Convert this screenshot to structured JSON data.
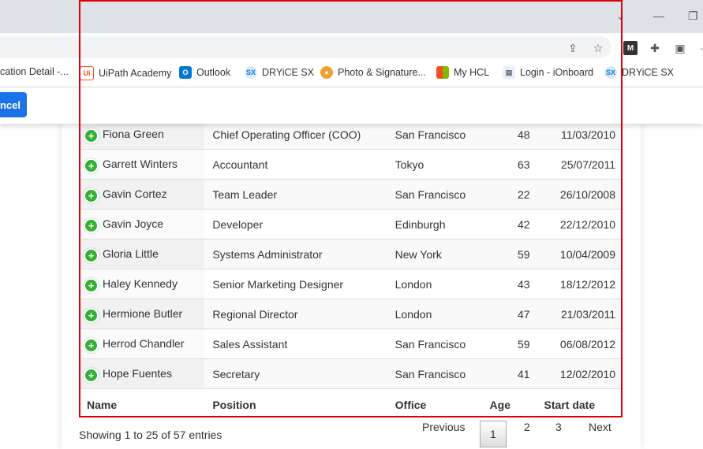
{
  "browser": {
    "bookmarks": [
      {
        "label": "cation Detail -...",
        "icon": "doc-icon",
        "color": "#4285f4"
      },
      {
        "label": "UiPath Academy",
        "icon": "uipath-icon",
        "color": "#fa4616"
      },
      {
        "label": "Outlook",
        "icon": "outlook-icon",
        "color": "#0078d4"
      },
      {
        "label": "DRYiCE SX",
        "icon": "sx-icon",
        "color": "#9fd4f5"
      },
      {
        "label": "Photo & Signature...",
        "icon": "photo-icon",
        "color": "#f0a030"
      },
      {
        "label": "My HCL",
        "icon": "microsoft-icon",
        "color": "#f25022"
      },
      {
        "label": "Login - iOnboard",
        "icon": "doc-icon",
        "color": "#8ab4f8"
      },
      {
        "label": "DRYiCE SX",
        "icon": "sx-icon",
        "color": "#9fd4f5"
      }
    ]
  },
  "dialog": {
    "cancel_label": "ncel"
  },
  "table": {
    "rows": [
      {
        "name": "Fiona Green",
        "position": "Chief Operating Officer (COO)",
        "office": "San Francisco",
        "age": "48",
        "start": "11/03/2010"
      },
      {
        "name": "Garrett Winters",
        "position": "Accountant",
        "office": "Tokyo",
        "age": "63",
        "start": "25/07/2011"
      },
      {
        "name": "Gavin Cortez",
        "position": "Team Leader",
        "office": "San Francisco",
        "age": "22",
        "start": "26/10/2008"
      },
      {
        "name": "Gavin Joyce",
        "position": "Developer",
        "office": "Edinburgh",
        "age": "42",
        "start": "22/12/2010"
      },
      {
        "name": "Gloria Little",
        "position": "Systems Administrator",
        "office": "New York",
        "age": "59",
        "start": "10/04/2009"
      },
      {
        "name": "Haley Kennedy",
        "position": "Senior Marketing Designer",
        "office": "London",
        "age": "43",
        "start": "18/12/2012"
      },
      {
        "name": "Hermione Butler",
        "position": "Regional Director",
        "office": "London",
        "age": "47",
        "start": "21/03/2011"
      },
      {
        "name": "Herrod Chandler",
        "position": "Sales Assistant",
        "office": "San Francisco",
        "age": "59",
        "start": "06/08/2012"
      },
      {
        "name": "Hope Fuentes",
        "position": "Secretary",
        "office": "San Francisco",
        "age": "41",
        "start": "12/02/2010"
      }
    ],
    "footer": {
      "name": "Name",
      "position": "Position",
      "office": "Office",
      "age": "Age",
      "start": "Start date"
    }
  },
  "pagination": {
    "info": "Showing 1 to 25 of 57 entries",
    "previous": "Previous",
    "pages": [
      "1",
      "2",
      "3"
    ],
    "next": "Next"
  },
  "colors": {
    "highlight": "#e0000a",
    "expand": "#31b131",
    "accent": "#1a73e8"
  }
}
